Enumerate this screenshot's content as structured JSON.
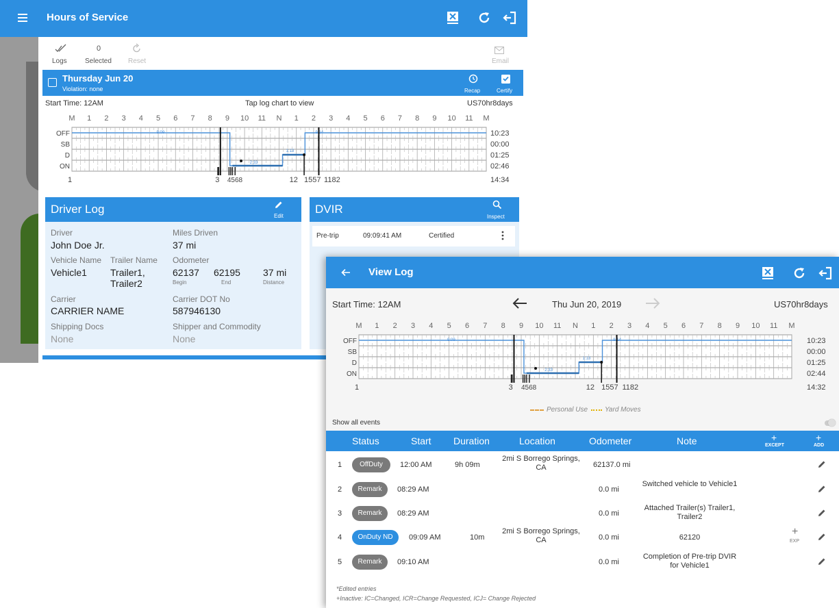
{
  "back": {
    "title": "Hours of Service",
    "toolbar": {
      "logs_label": "Logs",
      "selected_count": "0",
      "selected_label": "Selected",
      "reset_label": "Reset",
      "email_label": "Email"
    },
    "day": {
      "title": "Thursday Jun 20",
      "violation": "Violation: none",
      "recap_label": "Recap",
      "certify_label": "Certify"
    },
    "chart_header": {
      "start_time": "Start Time: 12AM",
      "hint": "Tap log chart to view",
      "ruleset": "US70hr8days"
    },
    "hour_labels": [
      "M",
      "1",
      "2",
      "3",
      "4",
      "5",
      "6",
      "7",
      "8",
      "9",
      "10",
      "11",
      "N",
      "1",
      "2",
      "3",
      "4",
      "5",
      "6",
      "7",
      "8",
      "9",
      "10",
      "11",
      "M"
    ],
    "status_labels": [
      "OFF",
      "SB",
      "D",
      "ON"
    ],
    "totals": [
      "10:23",
      "00:00",
      "01:25",
      "02:46",
      "14:34"
    ],
    "bottom_labels": {
      "left": "1",
      "a": "3",
      "b": "4568",
      "c": "12",
      "d": "1557",
      "e": "1182"
    },
    "driver_log": {
      "title": "Driver Log",
      "edit_label": "Edit",
      "driver_label": "Driver",
      "driver": "John Doe Jr.",
      "miles_label": "Miles Driven",
      "miles": "37 mi",
      "vehicle_label": "Vehicle Name",
      "vehicle": "Vehicle1",
      "trailer_label": "Trailer Name",
      "trailer": "Trailer1, Trailer2",
      "odometer_label": "Odometer",
      "odo_begin": "62137",
      "odo_begin_label": "Begin",
      "odo_end": "62195",
      "odo_end_label": "End",
      "odo_distance": "37 mi",
      "odo_distance_label": "Distance",
      "carrier_label": "Carrier",
      "carrier": "CARRIER NAME",
      "dot_label": "Carrier DOT No",
      "dot": "587946130",
      "shipping_label": "Shipping Docs",
      "shipping": "None",
      "shipper_label": "Shipper and Commodity",
      "shipper": "None"
    },
    "dvir": {
      "title": "DVIR",
      "inspect_label": "Inspect",
      "type": "Pre-trip",
      "time": "09:09:41 AM",
      "status": "Certified"
    }
  },
  "front": {
    "title": "View Log",
    "start_time": "Start Time: 12AM",
    "date": "Thu Jun 20, 2019",
    "ruleset": "US70hr8days",
    "totals": [
      "10:23",
      "00:00",
      "01:25",
      "02:44",
      "14:32"
    ],
    "legend": {
      "personal": "Personal Use",
      "yard": "Yard Moves"
    },
    "show_all_events": "Show all events",
    "columns": {
      "status": "Status",
      "start": "Start",
      "duration": "Duration",
      "location": "Location",
      "odometer": "Odometer",
      "note": "Note",
      "except": "EXCEPT",
      "add": "ADD"
    },
    "rows": [
      {
        "num": "1",
        "status": "OffDuty",
        "start": "12:00 AM",
        "duration": "9h 09m",
        "location": "2mi S Borrego Springs, CA",
        "odometer": "62137.0 mi",
        "note": ""
      },
      {
        "num": "2",
        "status": "Remark",
        "start": "08:29 AM",
        "duration": "",
        "location": "",
        "odometer": "0.0 mi",
        "note": "Switched vehicle to Vehicle1"
      },
      {
        "num": "3",
        "status": "Remark",
        "start": "08:29 AM",
        "duration": "",
        "location": "",
        "odometer": "0.0 mi",
        "note": "Attached Trailer(s) Trailer1, Trailer2"
      },
      {
        "num": "4",
        "status": "OnDuty ND",
        "start": "09:09 AM",
        "duration": "10m",
        "location": "2mi S Borrego Springs, CA",
        "odometer": "0.0 mi",
        "note": "62120",
        "exp": "EXP"
      },
      {
        "num": "5",
        "status": "Remark",
        "start": "09:10 AM",
        "duration": "",
        "location": "",
        "odometer": "0.0 mi",
        "note": "Completion of Pre-trip DVIR for Vehicle1"
      }
    ],
    "footnote1": "*Edited entries",
    "footnote2": "+Inactive: IC=Changed, ICR=Change Requested, ICJ= Change Rejected"
  },
  "colors": {
    "primary": "#2d8fe0",
    "chip_gray": "#7a7a7a",
    "chip_blue": "#2d8fe0",
    "panel": "#e6f1fb"
  }
}
